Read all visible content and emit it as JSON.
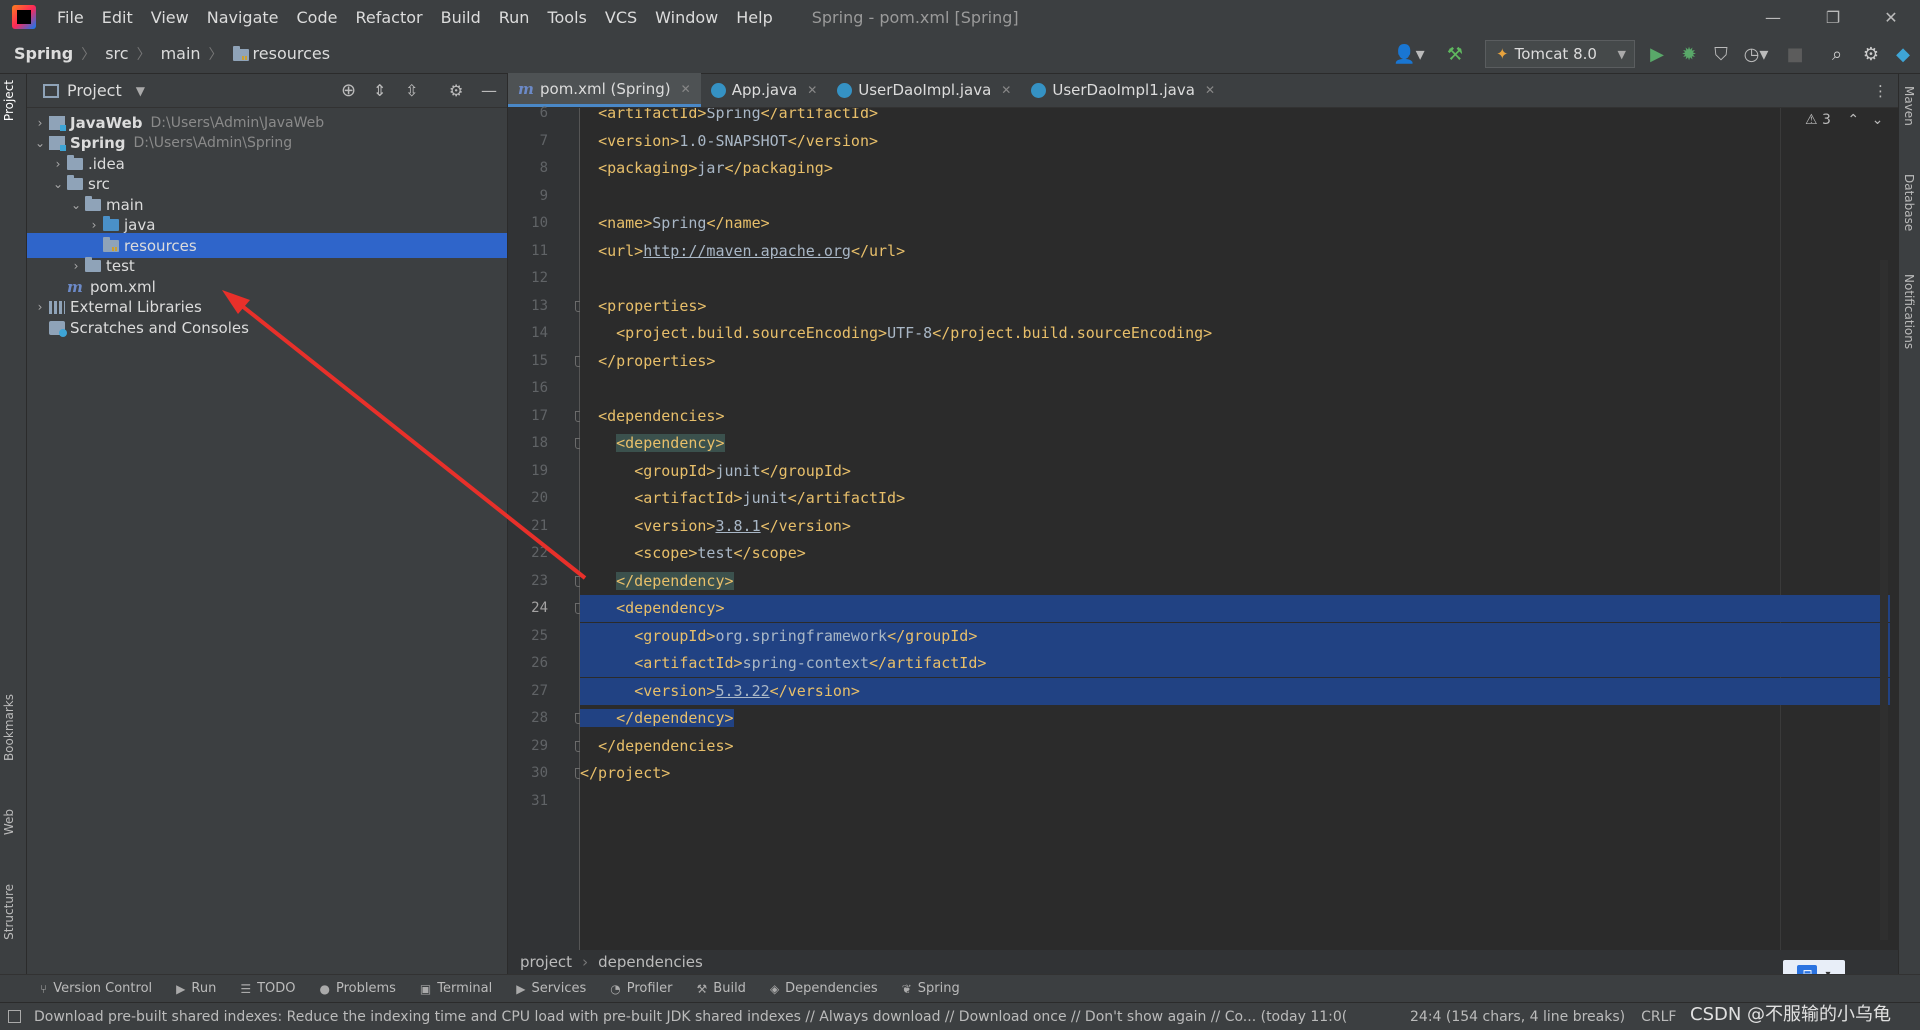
{
  "menu": {
    "items": [
      "File",
      "Edit",
      "View",
      "Navigate",
      "Code",
      "Refactor",
      "Build",
      "Run",
      "Tools",
      "VCS",
      "Window",
      "Help"
    ],
    "window_title": "Spring - pom.xml [Spring]"
  },
  "navbar": {
    "crumbs": [
      "Spring",
      "src",
      "main",
      "resources"
    ],
    "run_config": "Tomcat 8.0"
  },
  "project_panel": {
    "title": "Project",
    "tree": [
      {
        "label": "JavaWeb",
        "path": "D:\\Users\\Admin\\JavaWeb",
        "level": 0,
        "arrow": "›",
        "icon": "module-icon",
        "bold": true
      },
      {
        "label": "Spring",
        "path": "D:\\Users\\Admin\\Spring",
        "level": 0,
        "arrow": "⌄",
        "icon": "module-icon",
        "bold": true
      },
      {
        "label": ".idea",
        "path": "",
        "level": 1,
        "arrow": "›",
        "icon": "folder-icon"
      },
      {
        "label": "src",
        "path": "",
        "level": 1,
        "arrow": "⌄",
        "icon": "folder-icon"
      },
      {
        "label": "main",
        "path": "",
        "level": 2,
        "arrow": "⌄",
        "icon": "folder-icon"
      },
      {
        "label": "java",
        "path": "",
        "level": 3,
        "arrow": "›",
        "icon": "source-folder-icon"
      },
      {
        "label": "resources",
        "path": "",
        "level": 3,
        "arrow": "",
        "icon": "resources-folder-icon",
        "selected": true
      },
      {
        "label": "test",
        "path": "",
        "level": 2,
        "arrow": "›",
        "icon": "folder-icon"
      },
      {
        "label": "pom.xml",
        "path": "",
        "level": 1,
        "arrow": "",
        "icon": "maven-icon"
      },
      {
        "label": "External Libraries",
        "path": "",
        "level": 0,
        "arrow": "›",
        "icon": "library-icon"
      },
      {
        "label": "Scratches and Consoles",
        "path": "",
        "level": 0,
        "arrow": "",
        "icon": "scratch-icon"
      }
    ]
  },
  "editor_tabs": [
    {
      "label": "pom.xml (Spring)",
      "icon": "maven-icon",
      "active": true
    },
    {
      "label": "App.java",
      "icon": "java-class-icon",
      "active": false
    },
    {
      "label": "UserDaoImpl.java",
      "icon": "java-class-icon",
      "active": false
    },
    {
      "label": "UserDaoImpl1.java",
      "icon": "java-class-icon",
      "active": false
    }
  ],
  "editor": {
    "warning_count": "3",
    "current_line": 24,
    "lines": [
      {
        "n": 6,
        "indent": 1,
        "segs": [
          [
            "t",
            "<artifactId>"
          ],
          [
            "x",
            "Spring"
          ],
          [
            "t",
            "</artifactId>"
          ]
        ]
      },
      {
        "n": 7,
        "indent": 1,
        "segs": [
          [
            "t",
            "<version>"
          ],
          [
            "x",
            "1.0-SNAPSHOT"
          ],
          [
            "t",
            "</version>"
          ]
        ]
      },
      {
        "n": 8,
        "indent": 1,
        "segs": [
          [
            "t",
            "<packaging>"
          ],
          [
            "x",
            "jar"
          ],
          [
            "t",
            "</packaging>"
          ]
        ]
      },
      {
        "n": 9,
        "indent": 0,
        "segs": []
      },
      {
        "n": 10,
        "indent": 1,
        "segs": [
          [
            "t",
            "<name>"
          ],
          [
            "x",
            "Spring"
          ],
          [
            "t",
            "</name>"
          ]
        ]
      },
      {
        "n": 11,
        "indent": 1,
        "segs": [
          [
            "t",
            "<url>"
          ],
          [
            "u",
            "http://maven.apache.org"
          ],
          [
            "t",
            "</url>"
          ]
        ]
      },
      {
        "n": 12,
        "indent": 0,
        "segs": []
      },
      {
        "n": 13,
        "indent": 1,
        "segs": [
          [
            "t",
            "<properties>"
          ]
        ],
        "fold": true
      },
      {
        "n": 14,
        "indent": 2,
        "segs": [
          [
            "t",
            "<project.build.sourceEncoding>"
          ],
          [
            "x",
            "UTF-8"
          ],
          [
            "t",
            "</project.build.sourceEncoding>"
          ]
        ]
      },
      {
        "n": 15,
        "indent": 1,
        "segs": [
          [
            "t",
            "</properties>"
          ]
        ],
        "fold": true
      },
      {
        "n": 16,
        "indent": 0,
        "segs": []
      },
      {
        "n": 17,
        "indent": 1,
        "segs": [
          [
            "t",
            "<dependencies>"
          ]
        ],
        "fold": true
      },
      {
        "n": 18,
        "indent": 2,
        "segs": [
          [
            "tb",
            "<dependency>"
          ]
        ],
        "fold": true
      },
      {
        "n": 19,
        "indent": 3,
        "segs": [
          [
            "t",
            "<groupId>"
          ],
          [
            "x",
            "junit"
          ],
          [
            "t",
            "</groupId>"
          ]
        ]
      },
      {
        "n": 20,
        "indent": 3,
        "segs": [
          [
            "t",
            "<artifactId>"
          ],
          [
            "x",
            "junit"
          ],
          [
            "t",
            "</artifactId>"
          ]
        ]
      },
      {
        "n": 21,
        "indent": 3,
        "segs": [
          [
            "t",
            "<version>"
          ],
          [
            "u",
            "3.8.1"
          ],
          [
            "t",
            "</version>"
          ]
        ]
      },
      {
        "n": 22,
        "indent": 3,
        "segs": [
          [
            "t",
            "<scope>"
          ],
          [
            "x",
            "test"
          ],
          [
            "t",
            "</scope>"
          ]
        ]
      },
      {
        "n": 23,
        "indent": 2,
        "segs": [
          [
            "tb",
            "</dependency>"
          ]
        ],
        "fold": true
      },
      {
        "n": 24,
        "indent": 2,
        "segs": [
          [
            "t",
            "<dependency>"
          ]
        ],
        "fold": true,
        "sel": "full"
      },
      {
        "n": 25,
        "indent": 3,
        "segs": [
          [
            "t",
            "<groupId>"
          ],
          [
            "x",
            "org.springframework"
          ],
          [
            "t",
            "</groupId>"
          ]
        ],
        "sel": "full"
      },
      {
        "n": 26,
        "indent": 3,
        "segs": [
          [
            "t",
            "<artifactId>"
          ],
          [
            "x",
            "spring-context"
          ],
          [
            "t",
            "</artifactId>"
          ]
        ],
        "sel": "full"
      },
      {
        "n": 27,
        "indent": 3,
        "segs": [
          [
            "t",
            "<version>"
          ],
          [
            "u",
            "5.3.22"
          ],
          [
            "t",
            "</version>"
          ]
        ],
        "sel": "full"
      },
      {
        "n": 28,
        "indent": 2,
        "segs": [
          [
            "t",
            "</dependency>"
          ]
        ],
        "fold": true,
        "sel": "part"
      },
      {
        "n": 29,
        "indent": 1,
        "segs": [
          [
            "t",
            "</dependencies>"
          ]
        ],
        "fold": true
      },
      {
        "n": 30,
        "indent": 0,
        "segs": [
          [
            "t",
            "</project>"
          ]
        ],
        "fold": true
      },
      {
        "n": 31,
        "indent": 0,
        "segs": []
      }
    ]
  },
  "editor_breadcrumb": [
    "project",
    "dependencies"
  ],
  "bottom_tools": [
    {
      "label": "Version Control",
      "icon": "vcs-icon",
      "glyph": "⑂"
    },
    {
      "label": "Run",
      "icon": "run-icon",
      "glyph": "▶"
    },
    {
      "label": "TODO",
      "icon": "todo-icon",
      "glyph": "☰"
    },
    {
      "label": "Problems",
      "icon": "problems-icon",
      "glyph": "●"
    },
    {
      "label": "Terminal",
      "icon": "terminal-icon",
      "glyph": "▣"
    },
    {
      "label": "Services",
      "icon": "services-icon",
      "glyph": "▶"
    },
    {
      "label": "Profiler",
      "icon": "profiler-icon",
      "glyph": "◔"
    },
    {
      "label": "Build",
      "icon": "build-icon",
      "glyph": "⚒"
    },
    {
      "label": "Dependencies",
      "icon": "dependencies-icon",
      "glyph": "◈"
    },
    {
      "label": "Spring",
      "icon": "spring-icon",
      "glyph": "❦"
    }
  ],
  "status": {
    "message": "Download pre-built shared indexes: Reduce the indexing time and CPU load with pre-built JDK shared indexes // Always download // Download once // Don't show again // Co... (today 11:0(",
    "position": "24:4 (154 chars, 4 line breaks)",
    "line_ending": "CRLF"
  },
  "sidebar_left": [
    "Project",
    "Bookmarks",
    "Web",
    "Structure"
  ],
  "sidebar_right": [
    "Maven",
    "Database",
    "Notifications"
  ],
  "watermark": "CSDN @不服输的小乌龟",
  "colors": {
    "selection": "#214283",
    "tree_selection": "#2f65ca",
    "tag": "#e8bf6a",
    "text": "#a9b7c6",
    "arrow": "#e8302a"
  }
}
